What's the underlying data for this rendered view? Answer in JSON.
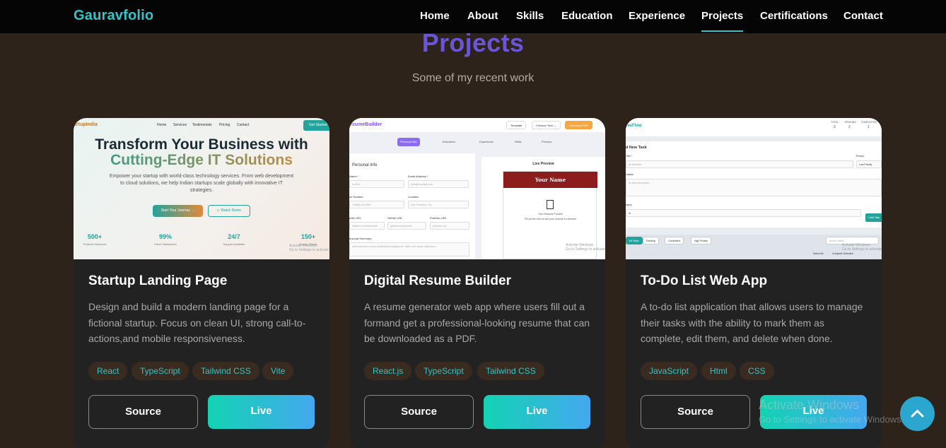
{
  "nav": {
    "brand": "Gauravfolio",
    "links": [
      "Home",
      "About",
      "Skills",
      "Education",
      "Experience",
      "Projects",
      "Certifications",
      "Contact"
    ],
    "active": "Projects"
  },
  "section": {
    "title": "Projects",
    "subtitle": "Some of my recent work"
  },
  "projects": [
    {
      "title": "Startup Landing Page",
      "description": "Design and build a modern landing page for a fictional startup. Focus on clean UI, strong call-to-actions,and mobile responsiveness.",
      "tags": [
        "React",
        "TypeScript",
        "Tailwind CSS",
        "Vite"
      ],
      "source_label": "Source",
      "live_label": "Live",
      "preview": {
        "logo": "artupIndia",
        "nav": [
          "Home",
          "Services",
          "Testimonials",
          "Pricing",
          "Contact"
        ],
        "cta_top": "Get Started",
        "headline_1": "Transform Your Business with",
        "headline_2": "Cutting-Edge IT Solutions",
        "paragraph": "Empower your startup with world-class technology services. From web development to cloud solutions, we help Indian startups scale globally with innovative IT strategies.",
        "button_primary": "Start Your Journey →",
        "button_secondary": "▷ Watch Demo",
        "stats": [
          {
            "value": "500+",
            "label": "Projects Delivered"
          },
          {
            "value": "99%",
            "label": "Client Satisfaction"
          },
          {
            "value": "24/7",
            "label": "Support Available"
          },
          {
            "value": "150+",
            "label": "Happy Clients"
          }
        ],
        "watermark": "Activate Windows\nGo to Settings to activate Windows."
      }
    },
    {
      "title": "Digital Resume Builder",
      "description": "A resume generator web app where users fill out a formand get a professional-looking resume that can be downloaded as a PDF.",
      "tags": [
        "React.js",
        "TypeScript",
        "Tailwind CSS"
      ],
      "source_label": "Source",
      "live_label": "Live",
      "preview": {
        "logo": "esumeBuilder",
        "chips": [
          "Template",
          "Crimson Tech ⌄",
          "Download PDF"
        ],
        "tabs": [
          "Personal Info",
          "Education",
          "Experience",
          "Skills",
          "Preview"
        ],
        "section": "Personal Info",
        "fields": [
          {
            "label": "Name *",
            "value": "hn Doe"
          },
          {
            "label": "Email Address *",
            "value": "john@example.com"
          },
          {
            "label": "ne Number",
            "value": "1 (555) 123-4567"
          },
          {
            "label": "Location",
            "value": "San Francisco, CA"
          },
          {
            "label": "edIn URL",
            "value": "inkedin.com/in/johndoe"
          },
          {
            "label": "GitHub URL",
            "value": "github.com/johndoe"
          },
          {
            "label": "Portfolio URL",
            "value": "johndoe.com"
          },
          {
            "label": "ersonal Summary",
            "value": "brief summary of your professional background, skills, and career objectives..."
          }
        ],
        "live_preview": "Live Preview",
        "your_name": "Your Name",
        "resume_preview": "Your Resume Preview",
        "resume_hint": "Fill out the form to see your resume in real-time",
        "watermark": "Activate Windows\nGo to Settings to activate Windows."
      }
    },
    {
      "title": "To-Do List Web App",
      "description": "A to-do list application that allows users to manage their tasks with the ability to mark them as complete, edit them, and delete when done.",
      "tags": [
        "JavaScript",
        "Html",
        "CSS"
      ],
      "source_label": "Source",
      "live_label": "Live",
      "preview": {
        "logo": "ravFlow",
        "stats": [
          "TOTAL",
          "PENDING",
          "COMPLETED"
        ],
        "stat_values": [
          "3",
          "2",
          "1"
        ],
        "panel_title": "d New Task",
        "title_label": "Title *",
        "title_placeholder": "ter task title...",
        "priority_label": "Priority",
        "priority_value": "Low Priority",
        "desc_label": "cription",
        "desc_placeholder": "ter task description...",
        "category_label": "egory",
        "category_value": "rk",
        "add_button": "+ Add Task",
        "filters": [
          "All Tasks",
          "Pending",
          "Completed",
          "High Priority"
        ],
        "search_placeholder": "Search tasks...",
        "footer_items": [
          "Select All",
          "Complete Selected"
        ],
        "watermark": "Activate Windows\nGo to Settings to activate Windows."
      }
    }
  ],
  "os_overlay": {
    "activate_title": "Activate Windows",
    "activate_sub": "Go to Settings to activate Windows."
  },
  "colors": {
    "accent": "#2fc5c9",
    "title": "#6a55d6",
    "background": "#2e231a",
    "card": "#222222"
  }
}
